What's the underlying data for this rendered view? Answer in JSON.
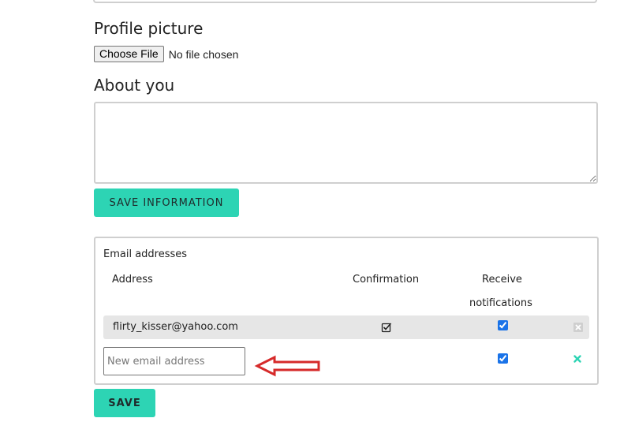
{
  "profile": {
    "title": "Profile picture",
    "file_button": "Choose File",
    "file_status": "No file chosen"
  },
  "about": {
    "title": "About you",
    "value": "",
    "save_label": "SAVE INFORMATION"
  },
  "email_panel": {
    "title": "Email addresses",
    "columns": {
      "address": "Address",
      "confirmation": "Confirmation",
      "notifications_line1": "Receive",
      "notifications_line2": "notifications"
    },
    "rows": [
      {
        "address": "flirty_kisser@yahoo.com",
        "confirmed": true,
        "receive_notifications": true
      }
    ],
    "new_email": {
      "placeholder": "New email address",
      "receive_notifications": true
    },
    "save_label": "SAVE"
  },
  "colors": {
    "accent": "#2dd4b4",
    "annotation_arrow": "#d62a2a",
    "row_background": "#e6e6e6"
  },
  "icons": {
    "confirmation": "checkbox-checked-icon",
    "remove_disabled": "close-disabled-icon",
    "remove_new": "close-icon",
    "annotation": "arrow-left-icon"
  }
}
